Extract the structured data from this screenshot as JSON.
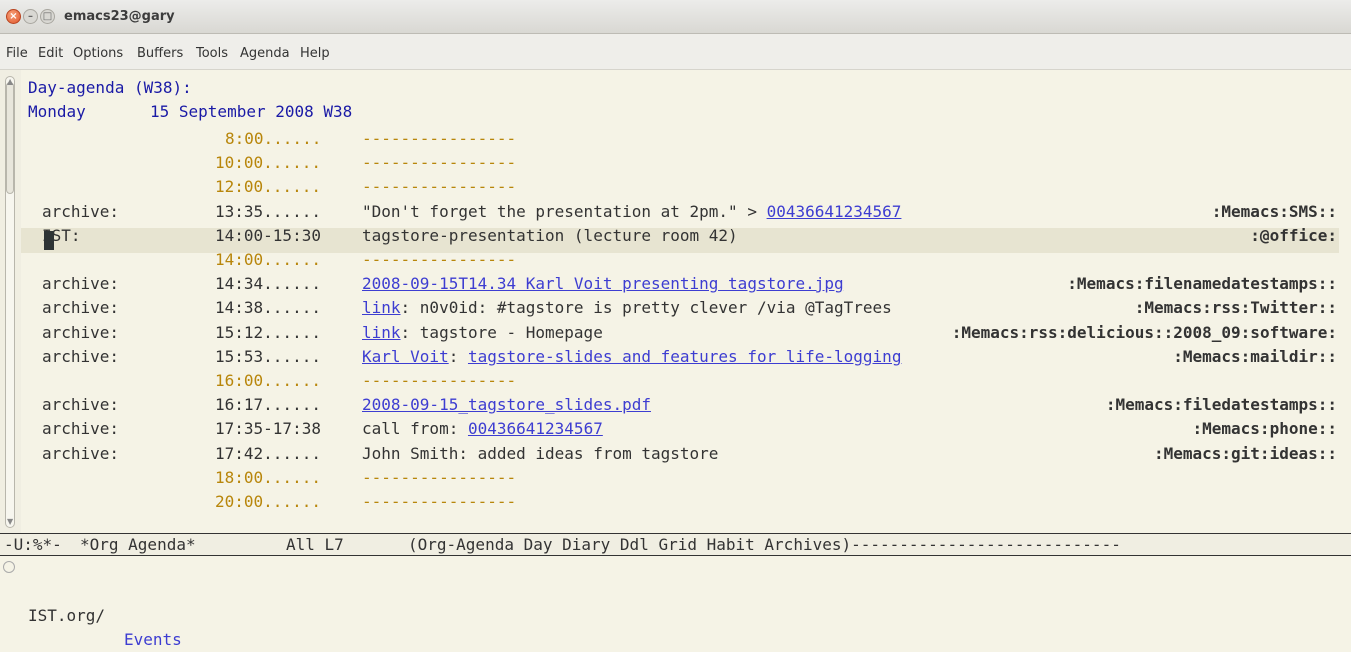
{
  "window": {
    "title": "emacs23@gary"
  },
  "menu": [
    "File",
    "Edit",
    "Options",
    "Buffers",
    "Tools",
    "Agenda",
    "Help"
  ],
  "agenda": {
    "header": "Day-agenda (W38):",
    "day_name": "Monday",
    "date": "15 September 2008 W38",
    "lines": [
      {
        "cat": "",
        "time": "8:00......",
        "text": "----------------",
        "grid": true
      },
      {
        "cat": "",
        "time": "10:00......",
        "text": "----------------",
        "grid": true
      },
      {
        "cat": "",
        "time": "12:00......",
        "text": "----------------",
        "grid": true
      },
      {
        "cat": "archive:",
        "time": "13:35......",
        "pre": "\"Don't forget the presentation at 2pm.\" > ",
        "link": "00436641234567",
        "tags": ":Memacs:SMS::"
      },
      {
        "cat": "IST:",
        "time": "14:00-15:30",
        "pre": "tagstore-presentation (lecture room 42)",
        "tags": ":@office:",
        "current": true
      },
      {
        "cat": "",
        "time": "14:00......",
        "text": "----------------",
        "grid": true
      },
      {
        "cat": "archive:",
        "time": "14:34......",
        "link": "2008-09-15T14.34 Karl Voit presenting tagstore.jpg",
        "tags": ":Memacs:filenamedatestamps::"
      },
      {
        "cat": "archive:",
        "time": "14:38......",
        "link": "link",
        "post": ": n0v0id: #tagstore is pretty clever /via @TagTrees",
        "tags": ":Memacs:rss:Twitter::"
      },
      {
        "cat": "archive:",
        "time": "15:12......",
        "link": "link",
        "post": ": tagstore - Homepage",
        "tags": ":Memacs:rss:delicious::2008_09:software:"
      },
      {
        "cat": "archive:",
        "time": "15:53......",
        "link": "Karl Voit",
        "post": ": ",
        "link2": "tagstore-slides and features for life-logging",
        "tags": ":Memacs:maildir::"
      },
      {
        "cat": "",
        "time": "16:00......",
        "text": "----------------",
        "grid": true
      },
      {
        "cat": "archive:",
        "time": "16:17......",
        "link": "2008-09-15_tagstore_slides.pdf",
        "tags": ":Memacs:filedatestamps::"
      },
      {
        "cat": "archive:",
        "time": "17:35-17:38",
        "pre": "call from: ",
        "link": "00436641234567",
        "tags": ":Memacs:phone::"
      },
      {
        "cat": "archive:",
        "time": "17:42......",
        "pre": "John Smith: added ideas from tagstore",
        "tags": ":Memacs:git:ideas::"
      },
      {
        "cat": "",
        "time": "18:00......",
        "text": "----------------",
        "grid": true
      },
      {
        "cat": "",
        "time": "20:00......",
        "text": "----------------",
        "grid": true
      }
    ]
  },
  "modeline": {
    "status": "-U:%*-",
    "buffer": "*Org Agenda*",
    "position": "All L7",
    "modes": "(Org-Agenda Day Diary Ddl Grid Habit Archives)----------------------------"
  },
  "minibuffer": {
    "path": "IST.org/",
    "current": "Events"
  }
}
